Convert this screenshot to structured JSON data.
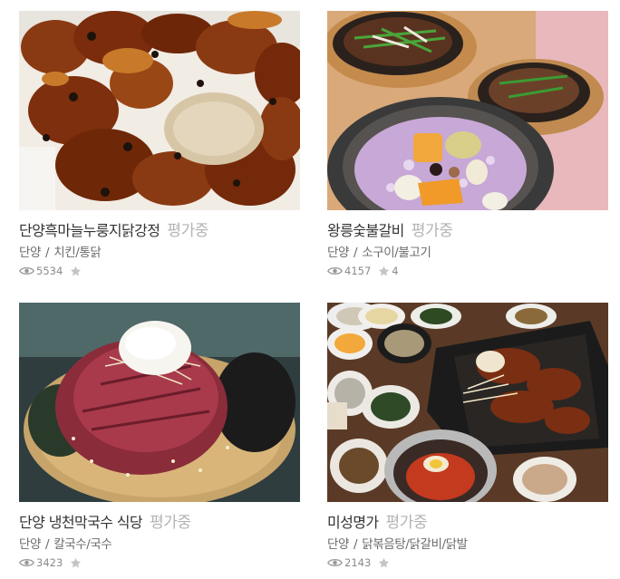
{
  "restaurants": [
    {
      "name": "단양흑마늘누룽지닭강정",
      "rating_status": "평가중",
      "region": "단양",
      "category": "치킨/통닭",
      "views": "5534",
      "reviews": "",
      "image": "fried-chicken-photo"
    },
    {
      "name": "왕릉숯불갈비",
      "rating_status": "평가중",
      "region": "단양",
      "category": "소구이/불고기",
      "views": "4157",
      "reviews": "4",
      "image": "stone-pot-rice-photo"
    },
    {
      "name": "단양 냉천막국수 식당",
      "rating_status": "평가중",
      "region": "단양",
      "category": "칼국수/국수",
      "views": "3423",
      "reviews": "",
      "image": "buckwheat-noodle-photo"
    },
    {
      "name": "미성명가",
      "rating_status": "평가중",
      "region": "단양",
      "category": "닭볶음탕/닭갈비/닭발",
      "views": "2143",
      "reviews": "",
      "image": "korean-table-spread-photo"
    }
  ],
  "separator": "/",
  "icons": {
    "views": "eye-icon",
    "reviews": "star-icon"
  },
  "colors": {
    "title": "#333333",
    "rating_status": "#b3b3b3",
    "meta": "#6b6b6b",
    "stats": "#8a8a8a"
  }
}
